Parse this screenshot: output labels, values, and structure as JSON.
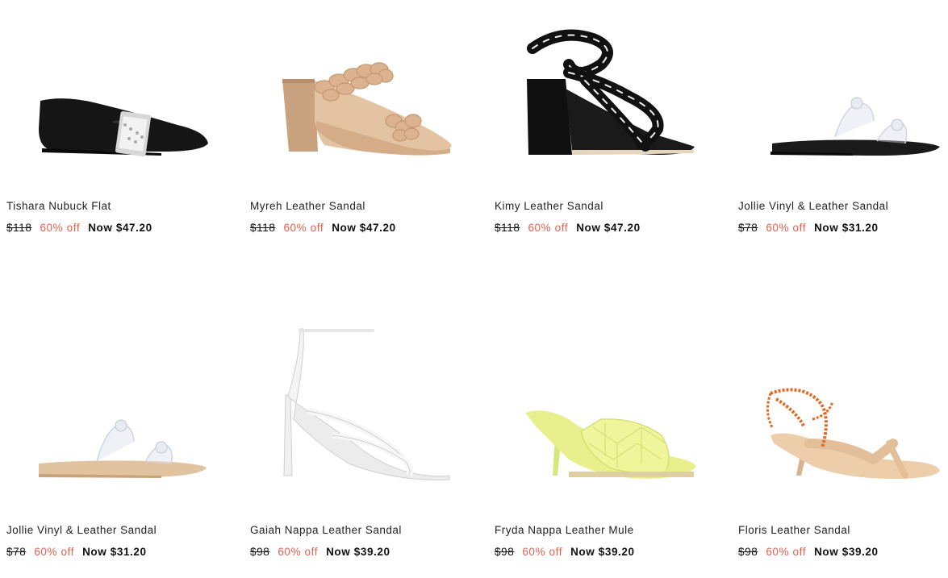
{
  "products": [
    {
      "name": "Tishara Nubuck Flat",
      "old_price": "$118",
      "discount": "60% off",
      "now_price": "Now $47.20",
      "image": "black-flat-with-jeweled-strap"
    },
    {
      "name": "Myreh Leather Sandal",
      "old_price": "$118",
      "discount": "60% off",
      "now_price": "Now $47.20",
      "image": "nude-braided-block-heel-sandal"
    },
    {
      "name": "Kimy Leather Sandal",
      "old_price": "$118",
      "discount": "60% off",
      "now_price": "Now $47.20",
      "image": "black-white-wrap-block-heel-sandal"
    },
    {
      "name": "Jollie Vinyl & Leather Sandal",
      "old_price": "$78",
      "discount": "60% off",
      "now_price": "Now $31.20",
      "image": "black-clear-flat-sandal"
    },
    {
      "name": "Jollie Vinyl & Leather Sandal",
      "old_price": "$78",
      "discount": "60% off",
      "now_price": "Now $31.20",
      "image": "nude-clear-flat-sandal"
    },
    {
      "name": "Gaiah Nappa Leather Sandal",
      "old_price": "$98",
      "discount": "60% off",
      "now_price": "Now $39.20",
      "image": "white-strappy-stiletto-sandal"
    },
    {
      "name": "Fryda Nappa Leather Mule",
      "old_price": "$98",
      "discount": "60% off",
      "now_price": "Now $39.20",
      "image": "yellow-quilted-mule"
    },
    {
      "name": "Floris Leather Sandal",
      "old_price": "$98",
      "discount": "60% off",
      "now_price": "Now $39.20",
      "image": "nude-thong-sandal-orange-lace"
    }
  ],
  "colors": {
    "discount": "#e8604c",
    "text": "#222222"
  }
}
